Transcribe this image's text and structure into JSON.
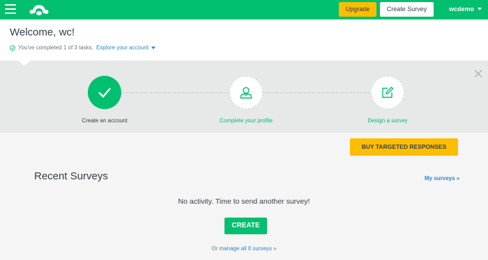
{
  "colors": {
    "brand_green": "#00bf6f",
    "accent_yellow": "#fdbd00",
    "link_blue": "#2d87c9"
  },
  "header": {
    "menu_icon": "hamburger-icon",
    "logo_icon": "surveymonkey-logo-icon",
    "upgrade_label": "Upgrade",
    "create_survey_label": "Create Survey",
    "username": "wcdemo",
    "user_caret_icon": "chevron-down-icon"
  },
  "welcome": {
    "title_prefix": "Welcome, ",
    "title_name": "wc",
    "title_suffix": "!",
    "check_icon": "check-circle-icon",
    "tasks_text": "You've completed 1 of 3 tasks.",
    "explore_link": "Explore your account",
    "explore_caret_icon": "chevron-down-icon"
  },
  "progress": {
    "close_icon": "close-icon",
    "steps": [
      {
        "label": "Create an account",
        "icon": "checkmark-icon",
        "completed": true
      },
      {
        "label": "Complete your profile",
        "icon": "user-profile-icon",
        "completed": false
      },
      {
        "label": "Design a survey",
        "icon": "edit-pencil-icon",
        "completed": false
      }
    ]
  },
  "main": {
    "buy_label": "BUY TARGETED RESPONSES",
    "recent_title": "Recent Surveys",
    "my_surveys_link": "My surveys »",
    "no_activity": "No activity. Time to send another survey!",
    "create_label": "CREATE",
    "manage_prefix": "Or ",
    "manage_link": "manage all 0 surveys »"
  }
}
